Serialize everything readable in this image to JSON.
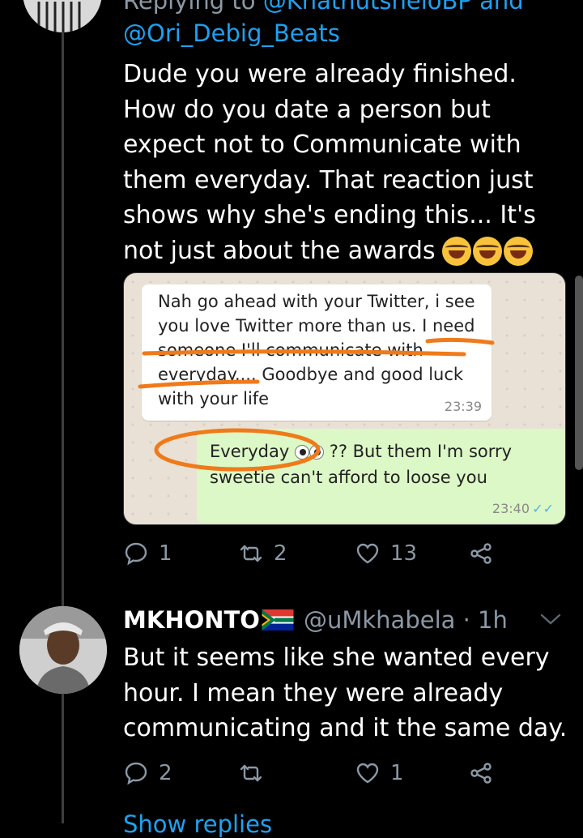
{
  "tweet1": {
    "reply_prefix": "Replying to",
    "reply_mention1": "@KhathutsheloBP and",
    "reply_mention2": "@Ori_Debig_Beats",
    "text": "Dude you were already finished. How do you date a person but expect not to Communicate with them everyday. That reaction just shows why she's ending this... It's not just about the awards",
    "emoji": "face-with-tears-of-joy x3",
    "media": {
      "incoming_message": "Nah go ahead with your Twitter, i see you love Twitter more than us. I need someone I'll communicate with everyday.... Goodbye and good luck with your life",
      "incoming_time": "23:39",
      "outgoing_message_1": "Everyday",
      "outgoing_message_2": "?? But them I'm sorry sweetie can't afford to loose you",
      "outgoing_time": "23:40",
      "annotation_color": "#f07a1a"
    },
    "actions": {
      "replies": "1",
      "retweets": "2",
      "likes": "13"
    }
  },
  "tweet2": {
    "name": "MKHONTO",
    "flag": "south-africa-flag",
    "handle": "@uMkhabela",
    "time": "· 1h",
    "text": "But it seems like she wanted every hour. I mean they were already communicating and it the same day.",
    "actions": {
      "replies": "2",
      "retweets": "",
      "likes": "1"
    }
  },
  "show_more": "Show replies",
  "colors": {
    "background": "#000000",
    "secondary": "#8b98a5",
    "link": "#1da1f2"
  }
}
